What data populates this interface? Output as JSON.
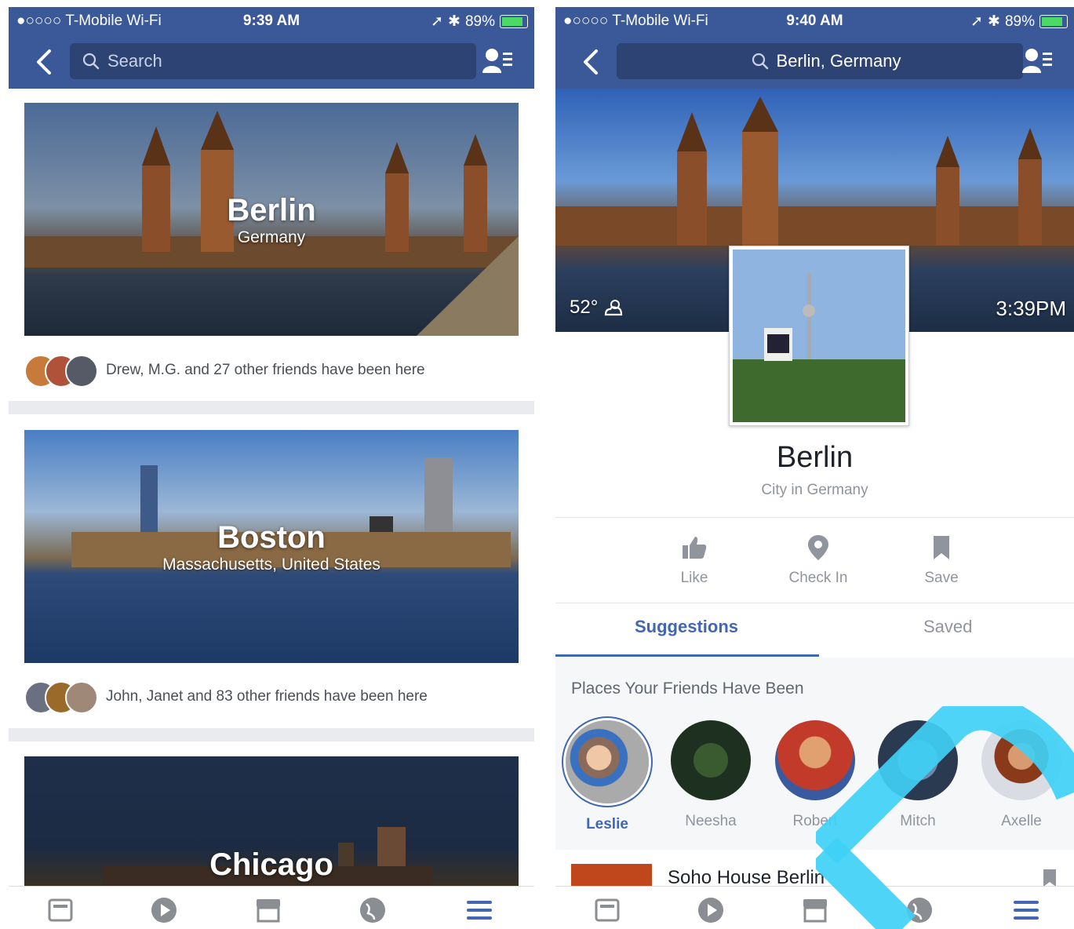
{
  "left_screen": {
    "status": {
      "carrier": "●○○○○ T-Mobile Wi-Fi",
      "time": "9:39 AM",
      "battery": "89%"
    },
    "search": {
      "placeholder": "Search"
    },
    "cards": [
      {
        "title": "Berlin",
        "subtitle": "Germany",
        "friends_text": "Drew, M.G. and 27 other friends have been here"
      },
      {
        "title": "Boston",
        "subtitle": "Massachusetts, United States",
        "friends_text": "John, Janet and 83 other friends have been here"
      },
      {
        "title": "Chicago",
        "subtitle": ""
      }
    ]
  },
  "right_screen": {
    "status": {
      "carrier": "●○○○○ T-Mobile Wi-Fi",
      "time": "9:40 AM",
      "battery": "89%"
    },
    "search": {
      "value": "Berlin, Germany"
    },
    "weather": "52°",
    "local_time": "3:39PM",
    "place": {
      "name": "Berlin",
      "category": "City in Germany"
    },
    "actions": [
      {
        "label": "Like",
        "icon": "thumbs-up-icon"
      },
      {
        "label": "Check In",
        "icon": "location-pin-icon"
      },
      {
        "label": "Save",
        "icon": "bookmark-icon"
      }
    ],
    "tabs": {
      "suggestions": "Suggestions",
      "saved": "Saved"
    },
    "section_title": "Places Your Friends Have Been",
    "friends": [
      "Leslie",
      "Neesha",
      "Robert",
      "Mitch",
      "Axelle"
    ],
    "place_row": {
      "name": "Soho House Berlin"
    }
  },
  "tabbar_icons": [
    "news-feed-icon",
    "video-icon",
    "marketplace-icon",
    "globe-icon",
    "menu-icon"
  ],
  "colors": {
    "brand": "#3b5998",
    "accent": "#4267b2",
    "muted": "#90949c",
    "watermark": "#3fd0f5"
  }
}
